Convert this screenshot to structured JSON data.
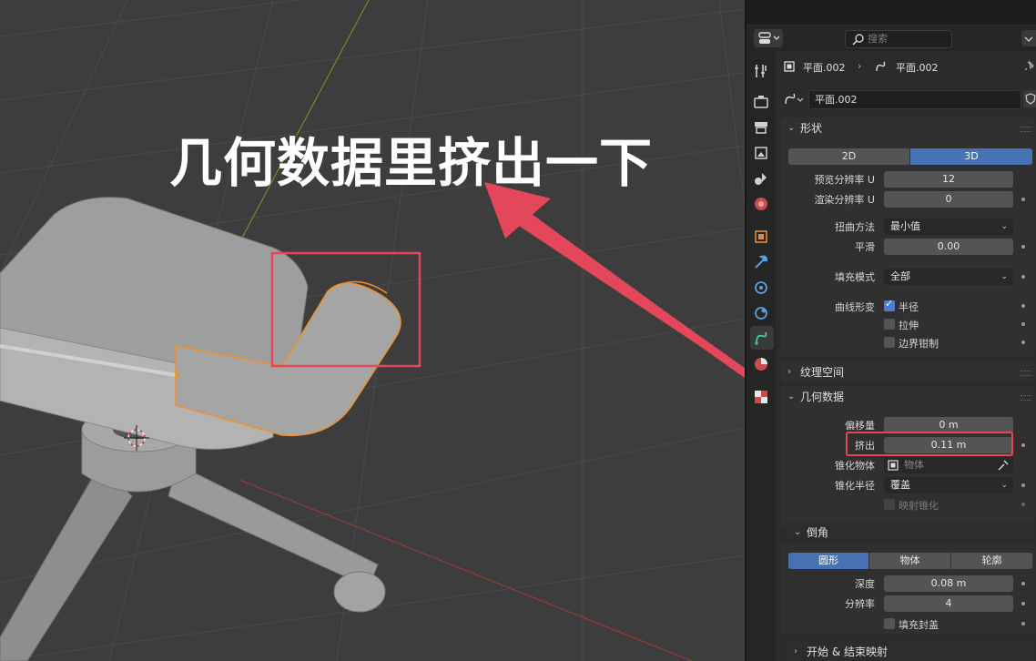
{
  "annotation": {
    "text": "几何数据里挤出一下"
  },
  "header": {
    "search_placeholder": "搜索"
  },
  "breadcrumb": {
    "object": "平面.002",
    "data": "平面.002"
  },
  "datablock": {
    "name": "平面.002"
  },
  "shape": {
    "title": "形状",
    "dim_2d": "2D",
    "dim_3d": "3D",
    "preview_res_label": "预览分辨率 U",
    "preview_res_value": "12",
    "render_res_label": "渲染分辨率 U",
    "render_res_value": "0",
    "twist_label": "扭曲方法",
    "twist_value": "最小值",
    "smooth_label": "平滑",
    "smooth_value": "0.00",
    "fill_label": "填充模式",
    "fill_value": "全部",
    "deform_label": "曲线形变",
    "radius_label": "半径",
    "stretch_label": "拉伸",
    "clamp_label": "边界钳制"
  },
  "texture_space": {
    "title": "纹理空间"
  },
  "geometry": {
    "title": "几何数据",
    "offset_label": "偏移量",
    "offset_value": "0 m",
    "extrude_label": "挤出",
    "extrude_value": "0.11 m",
    "taper_label": "锥化物体",
    "taper_placeholder": "物体",
    "taper_radius_label": "锥化半径",
    "taper_radius_value": "覆盖",
    "map_taper_label": "映射锥化"
  },
  "bevel": {
    "title": "倒角",
    "mode_round": "圆形",
    "mode_object": "物体",
    "mode_profile": "轮廓",
    "depth_label": "深度",
    "depth_value": "0.08 m",
    "resolution_label": "分辨率",
    "resolution_value": "4",
    "fill_caps_label": "填充封盖"
  },
  "start_end": {
    "title": "开始 & 结束映射"
  },
  "colors": {
    "accent": "#4772b3",
    "highlight": "#e5475a",
    "selection": "#f0902a"
  }
}
